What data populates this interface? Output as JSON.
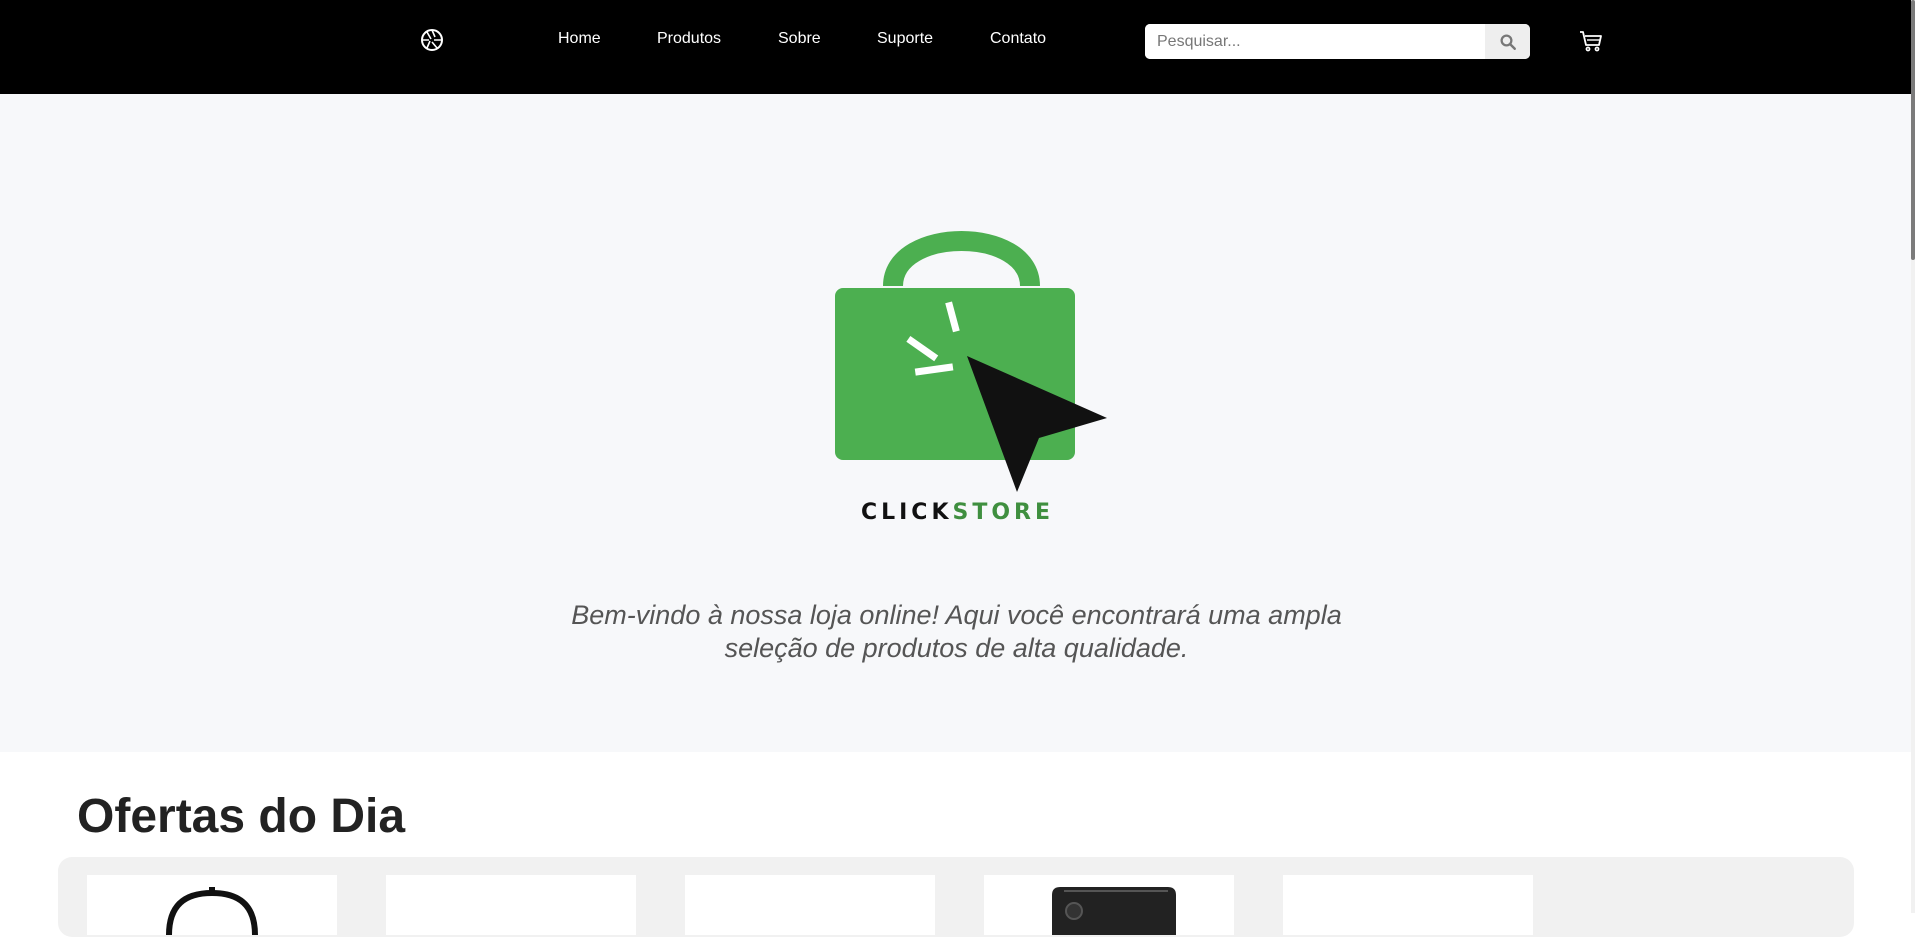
{
  "header": {
    "logo_icon": "aperture-icon",
    "nav": {
      "home": "Home",
      "produtos": "Produtos",
      "sobre": "Sobre",
      "suporte": "Suporte",
      "contato": "Contato"
    },
    "search": {
      "placeholder": "Pesquisar...",
      "button_icon": "search-icon"
    },
    "cart_icon": "cart-icon"
  },
  "hero": {
    "brand": {
      "part1": "CLICK",
      "part2": "STORE"
    },
    "welcome_text": "Bem-vindo à nossa loja online! Aqui você encontrará uma ampla seleção de produtos de alta qualidade."
  },
  "offers": {
    "title": "Ofertas do Dia",
    "cards": [
      {
        "image": "headphones-image"
      },
      {
        "image": "blank-image"
      },
      {
        "image": "blank-image"
      },
      {
        "image": "phone-image"
      },
      {
        "image": "blank-image"
      }
    ]
  },
  "colors": {
    "header_bg": "#000000",
    "hero_bg": "#f7f8fa",
    "brand_green": "#4caf50",
    "brand_dark": "#111111"
  }
}
